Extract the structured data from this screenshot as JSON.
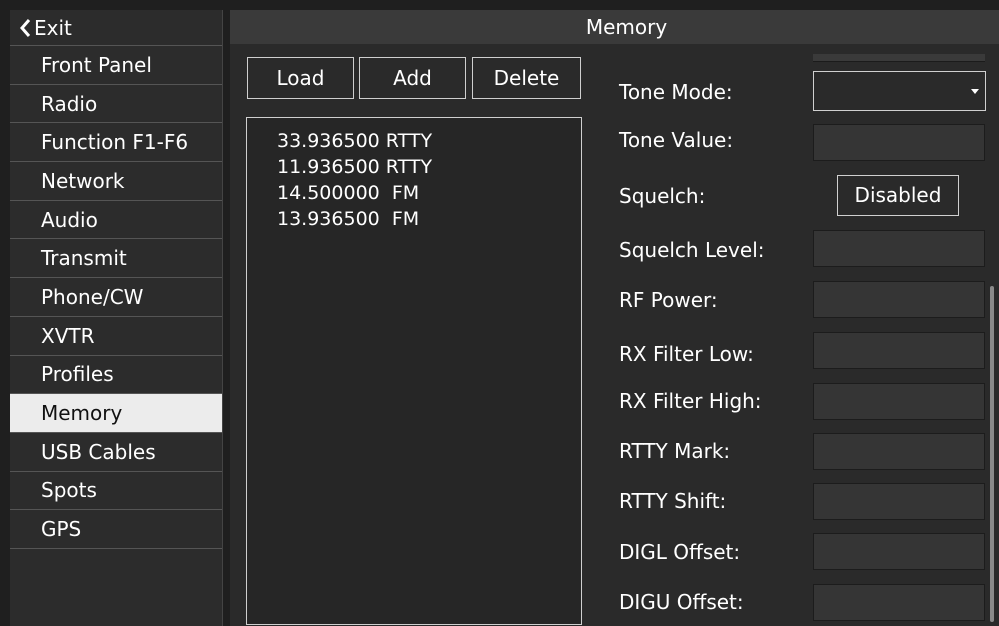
{
  "sidebar": {
    "exit_label": "Exit",
    "items": [
      {
        "label": "Front Panel"
      },
      {
        "label": "Radio"
      },
      {
        "label": "Function F1-F6"
      },
      {
        "label": "Network"
      },
      {
        "label": "Audio"
      },
      {
        "label": "Transmit"
      },
      {
        "label": "Phone/CW"
      },
      {
        "label": "XVTR"
      },
      {
        "label": "Profiles"
      },
      {
        "label": "Memory",
        "active": true
      },
      {
        "label": "USB Cables"
      },
      {
        "label": "Spots"
      },
      {
        "label": "GPS"
      }
    ]
  },
  "main": {
    "title": "Memory",
    "buttons": {
      "load": "Load",
      "add": "Add",
      "delete": "Delete"
    },
    "memories": [
      "33.936500 RTTY",
      "11.936500 RTTY",
      "14.500000  FM",
      "13.936500  FM"
    ],
    "fields": {
      "tone_mode": {
        "label": "Tone Mode:",
        "value": ""
      },
      "tone_value": {
        "label": "Tone Value:",
        "value": ""
      },
      "squelch": {
        "label": "Squelch:",
        "value": "Disabled"
      },
      "squelch_level": {
        "label": "Squelch Level:",
        "value": ""
      },
      "rf_power": {
        "label": "RF Power:",
        "value": ""
      },
      "rx_filter_low": {
        "label": "RX Filter Low:",
        "value": ""
      },
      "rx_filter_high": {
        "label": "RX Filter High:",
        "value": ""
      },
      "rtty_mark": {
        "label": "RTTY Mark:",
        "value": ""
      },
      "rtty_shift": {
        "label": "RTTY Shift:",
        "value": ""
      },
      "digl_offset": {
        "label": "DIGL Offset:",
        "value": ""
      },
      "digu_offset": {
        "label": "DIGU Offset:",
        "value": ""
      }
    }
  },
  "colors": {
    "background": "#1f1f1f",
    "sidebar": "#2c2c2c",
    "active_item": "#ececec",
    "panel": "#2a2a2a",
    "title_bar": "#3a3a3a",
    "field": "#353535",
    "border": "#cfcfcf"
  },
  "icons": {
    "exit": "chevron-left-icon",
    "dropdown": "caret-down-icon"
  }
}
